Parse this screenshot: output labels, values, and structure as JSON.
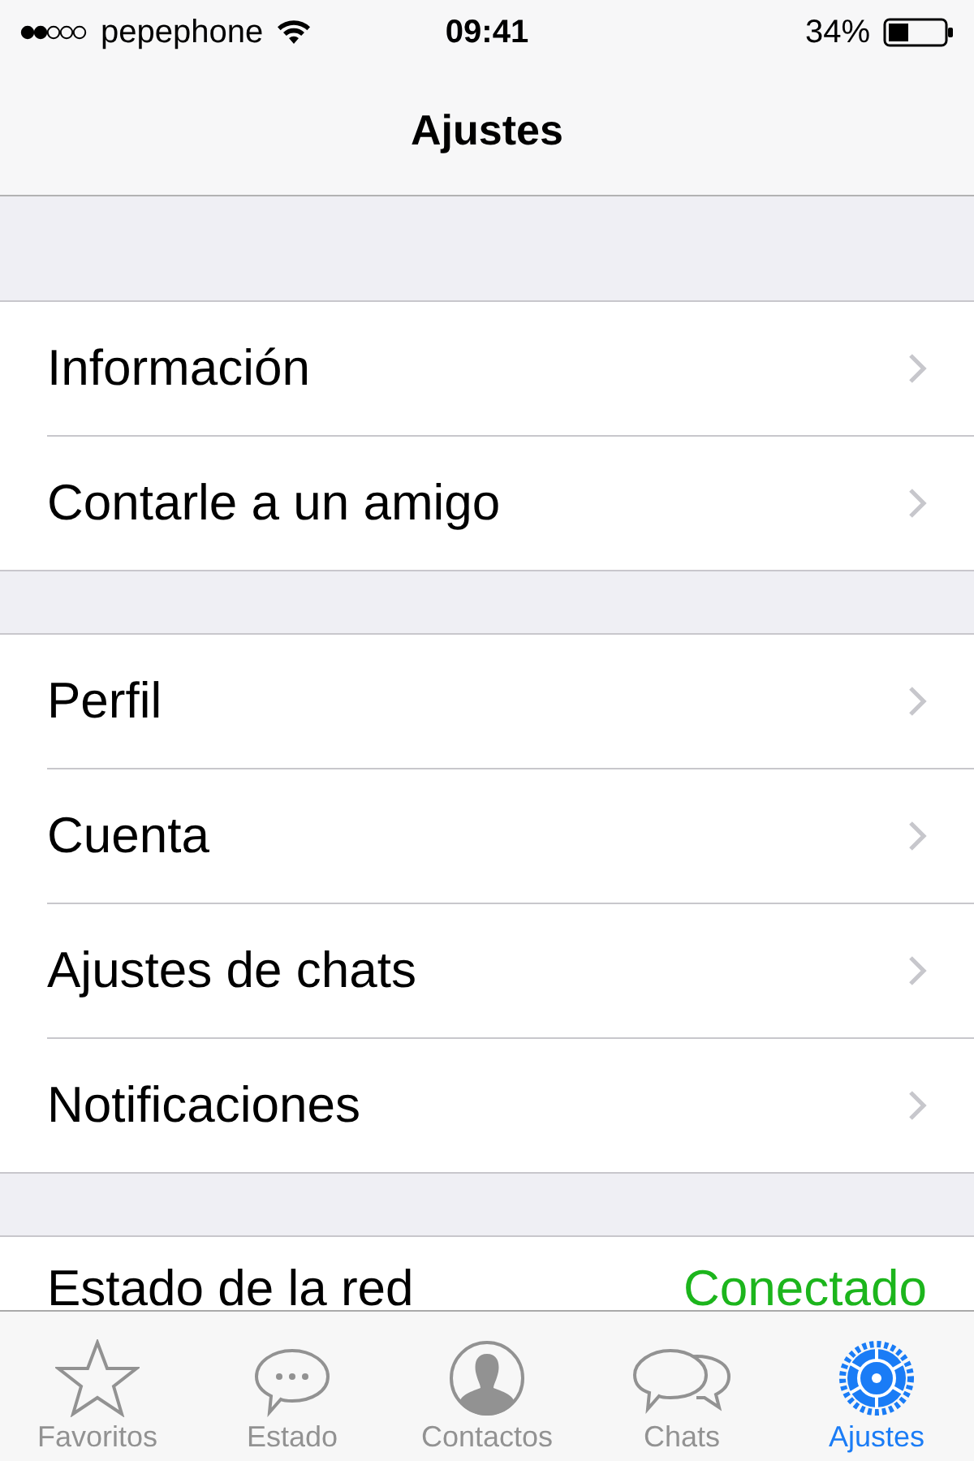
{
  "status_bar": {
    "carrier": "pepephone",
    "time": "09:41",
    "battery": "34%"
  },
  "nav_bar": {
    "title": "Ajustes"
  },
  "sections": [
    {
      "rows": [
        {
          "label": "Información",
          "kind": "link"
        },
        {
          "label": "Contarle a un amigo",
          "kind": "link"
        }
      ]
    },
    {
      "rows": [
        {
          "label": "Perfil",
          "kind": "link"
        },
        {
          "label": "Cuenta",
          "kind": "link"
        },
        {
          "label": "Ajustes de chats",
          "kind": "link"
        },
        {
          "label": "Notificaciones",
          "kind": "link"
        }
      ]
    },
    {
      "rows": [
        {
          "label": "Estado de la red",
          "kind": "value",
          "value": "Conectado"
        }
      ]
    }
  ],
  "tab_bar": [
    {
      "label": "Favoritos",
      "selected": false
    },
    {
      "label": "Estado",
      "selected": false
    },
    {
      "label": "Contactos",
      "selected": false
    },
    {
      "label": "Chats",
      "selected": false
    },
    {
      "label": "Ajustes",
      "selected": true
    }
  ]
}
